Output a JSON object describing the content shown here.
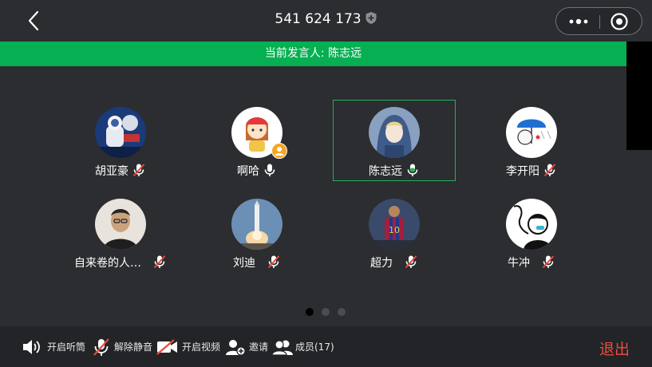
{
  "header": {
    "meeting_id": "541 624 173",
    "icons": [
      "back-icon",
      "shield-icon",
      "more-icon",
      "target-icon"
    ]
  },
  "banner": {
    "text": "当前发言人: 陈志远"
  },
  "members": [
    {
      "name": "胡亚豪",
      "mic": "muted",
      "avatar": "astronaut"
    },
    {
      "name": "啊哈",
      "mic": "on",
      "avatar": "cartoon-girl",
      "badge": "host"
    },
    {
      "name": "陈志远",
      "mic": "speaking",
      "avatar": "hooded-figure",
      "active": true
    },
    {
      "name": "李开阳",
      "mic": "muted",
      "avatar": "umbrella-doodle"
    },
    {
      "name": "自来卷的人…",
      "mic": "muted",
      "avatar": "man-portrait"
    },
    {
      "name": "刘迪",
      "mic": "muted",
      "avatar": "rocket-launch"
    },
    {
      "name": "超力",
      "mic": "muted",
      "avatar": "soccer-player"
    },
    {
      "name": "牛冲",
      "mic": "muted",
      "avatar": "sketch-figure"
    }
  ],
  "pagination": {
    "pages": 3,
    "current": 1
  },
  "toolbar": {
    "speaker_label": "开启听筒",
    "unmute_label": "解除静音",
    "video_label": "开启视频",
    "invite_label": "邀请",
    "members_label": "成员(17)",
    "exit_label": "退出"
  },
  "colors": {
    "background": "#2b2d30",
    "banner": "#06b052",
    "speaking_mic": "#1db954",
    "muted_slash": "#e8473b",
    "exit": "#f04a3e"
  }
}
